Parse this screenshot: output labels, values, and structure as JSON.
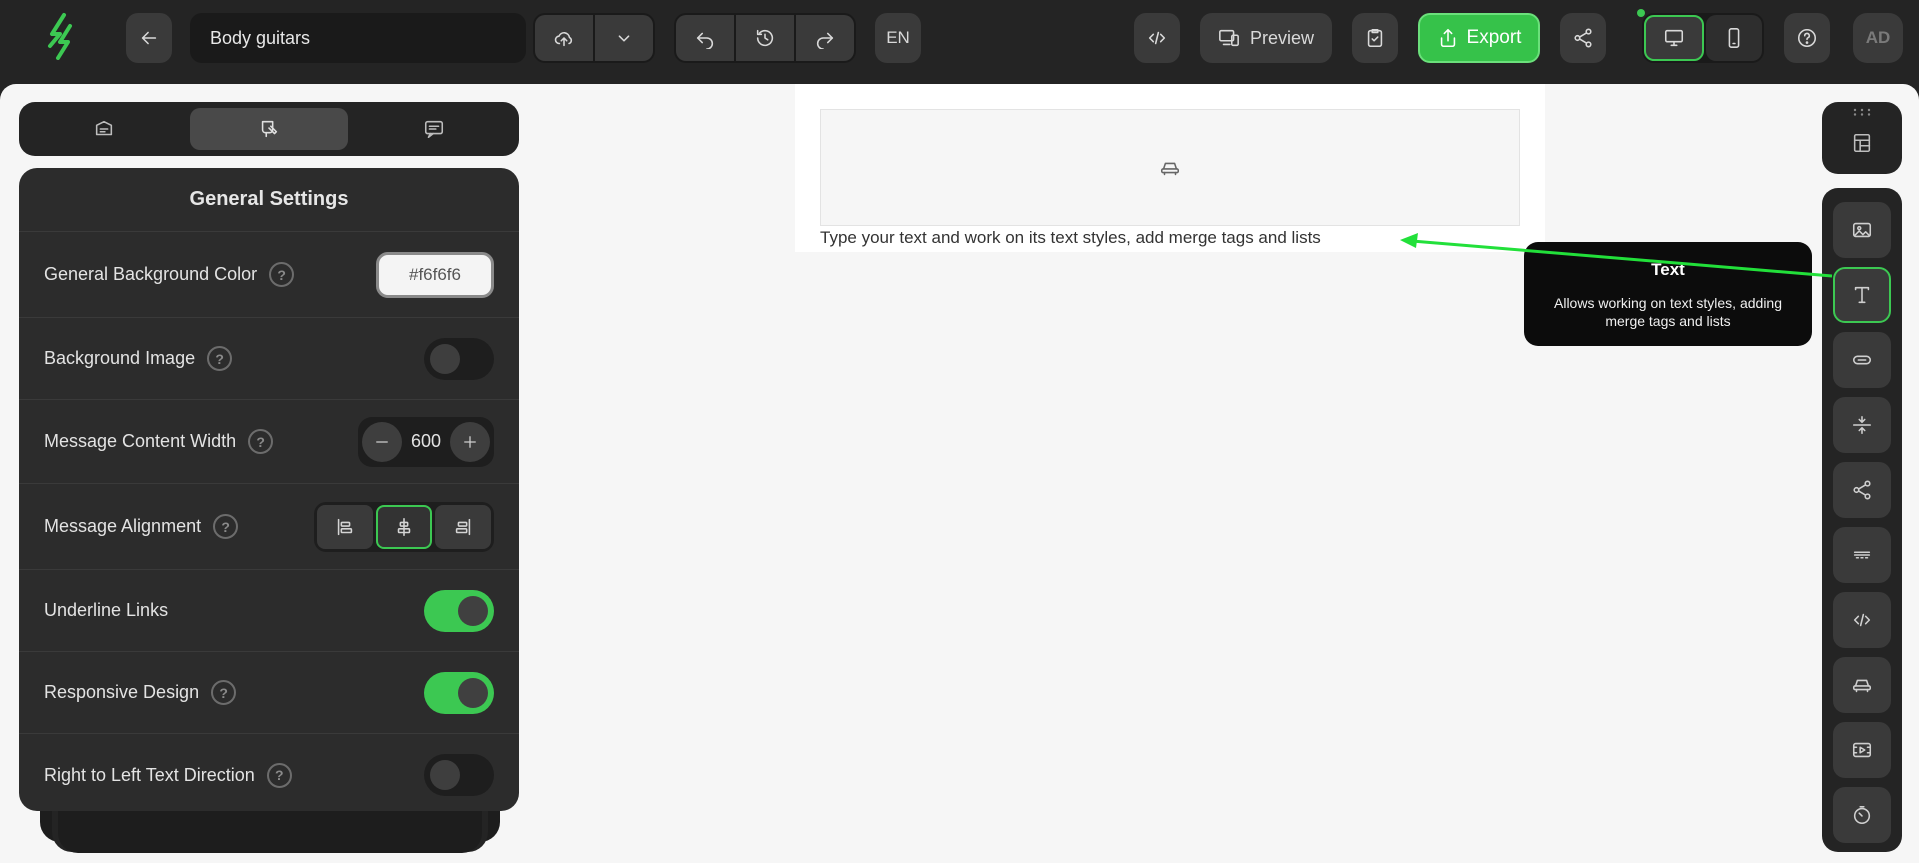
{
  "toolbar": {
    "title": "Body guitars",
    "language": "EN",
    "preview_label": "Preview",
    "export_label": "Export",
    "avatar_initials": "AD"
  },
  "colors": {
    "accent": "#3cc852",
    "canvas_bg": "#f6f6f6",
    "dark_bg": "#242424"
  },
  "panel": {
    "tabs": [
      "content-tab",
      "design-tab",
      "comments-tab"
    ],
    "active_tab": 1,
    "title": "General Settings",
    "rows": {
      "bg_color": {
        "label": "General Background Color",
        "value": "#f6f6f6"
      },
      "bg_image": {
        "label": "Background Image",
        "enabled": false
      },
      "content_width": {
        "label": "Message Content Width",
        "value": "600"
      },
      "alignment": {
        "label": "Message Alignment",
        "selected": "center"
      },
      "underline_links": {
        "label": "Underline Links",
        "enabled": true
      },
      "responsive": {
        "label": "Responsive Design",
        "enabled": true
      },
      "rtl": {
        "label": "Right to Left Text Direction",
        "enabled": false
      }
    }
  },
  "canvas": {
    "text_block": "Type your text and work on its text styles, add merge tags and lists"
  },
  "tooltip": {
    "title": "Text",
    "description": "Allows working on text styles, adding merge tags and lists"
  },
  "right_toolbar": {
    "tools": [
      "image-icon",
      "text-icon",
      "button-icon",
      "spacer-icon",
      "social-icon",
      "divider-icon",
      "html-icon",
      "block-icon",
      "video-icon",
      "timer-icon"
    ],
    "active_tool": "text-icon"
  }
}
